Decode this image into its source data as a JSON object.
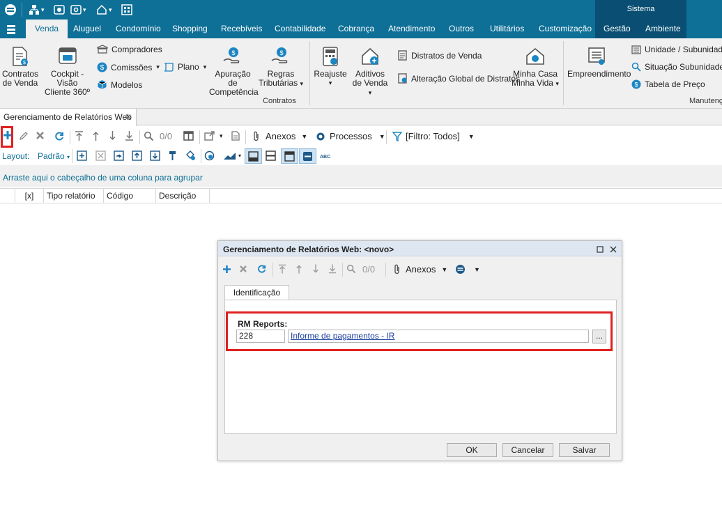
{
  "quick_access": {
    "items": [
      "logo-icon",
      "hierarchy-icon",
      "view-icon",
      "window-icon",
      "home-icon",
      "grid-icon"
    ]
  },
  "system_group": {
    "label": "Sistema"
  },
  "menu": {
    "tabs": [
      "Venda",
      "Aluguel",
      "Condomínio",
      "Shopping",
      "Recebíveis",
      "Contabilidade",
      "Cobrança",
      "Atendimento",
      "Outros",
      "Utilitários",
      "Customização",
      "Gestão",
      "Ambiente"
    ],
    "active": "Venda"
  },
  "ribbon": {
    "contratos_venda": "Contratos\nde Venda",
    "contratos_venda_l1": "Contratos",
    "contratos_venda_l2": "de Venda",
    "cockpit_l1": "Cockpit - Visão",
    "cockpit_l2": "Cliente 360º",
    "compradores": "Compradores",
    "comissoes": "Comissões",
    "modelos": "Modelos",
    "plano": "Plano",
    "apuracao_l1": "Apuração de",
    "apuracao_l2": "Competência",
    "regras_l1": "Regras",
    "regras_l2": "Tributárias",
    "reajuste": "Reajuste",
    "aditivos_l1": "Aditivos",
    "aditivos_l2": "de Venda",
    "distratos": "Distratos de Venda",
    "alteracao": "Alteração Global de Distratos",
    "minha_casa_l1": "Minha Casa",
    "minha_casa_l2": "Minha Vida",
    "group_contratos": "Contratos",
    "empreendimento": "Empreendimento",
    "unidade": "Unidade / Subunidade",
    "situacao": "Situação Subunidade",
    "tabela": "Tabela de Preço",
    "group_manutencao": "Manutenç"
  },
  "doc_tab": {
    "label": "Gerenciamento de Relatórios Web",
    "close": "✕"
  },
  "toolbar": {
    "counter": "0/0",
    "anexos": "Anexos",
    "processos": "Processos",
    "filtro": "[Filtro: Todos]"
  },
  "layout_bar": {
    "label": "Layout:",
    "value": "Padrão"
  },
  "group_hint": "Arraste aqui o cabeçalho de uma coluna para agrupar",
  "grid": {
    "columns": [
      "[x]",
      "Tipo relatório",
      "Código",
      "Descrição"
    ]
  },
  "dialog": {
    "title": "Gerenciamento de Relatórios Web: <novo>",
    "counter": "0/0",
    "anexos": "Anexos",
    "tab": "Identificação",
    "field_label": "RM Reports:",
    "code_value": "228",
    "desc_value": "Informe de pagamentos - IR",
    "browse": "...",
    "ok": "OK",
    "cancel": "Cancelar",
    "save": "Salvar"
  },
  "colors": {
    "brand": "#0e6f97",
    "dark": "#0a4f73",
    "highlight": "#e02020"
  }
}
